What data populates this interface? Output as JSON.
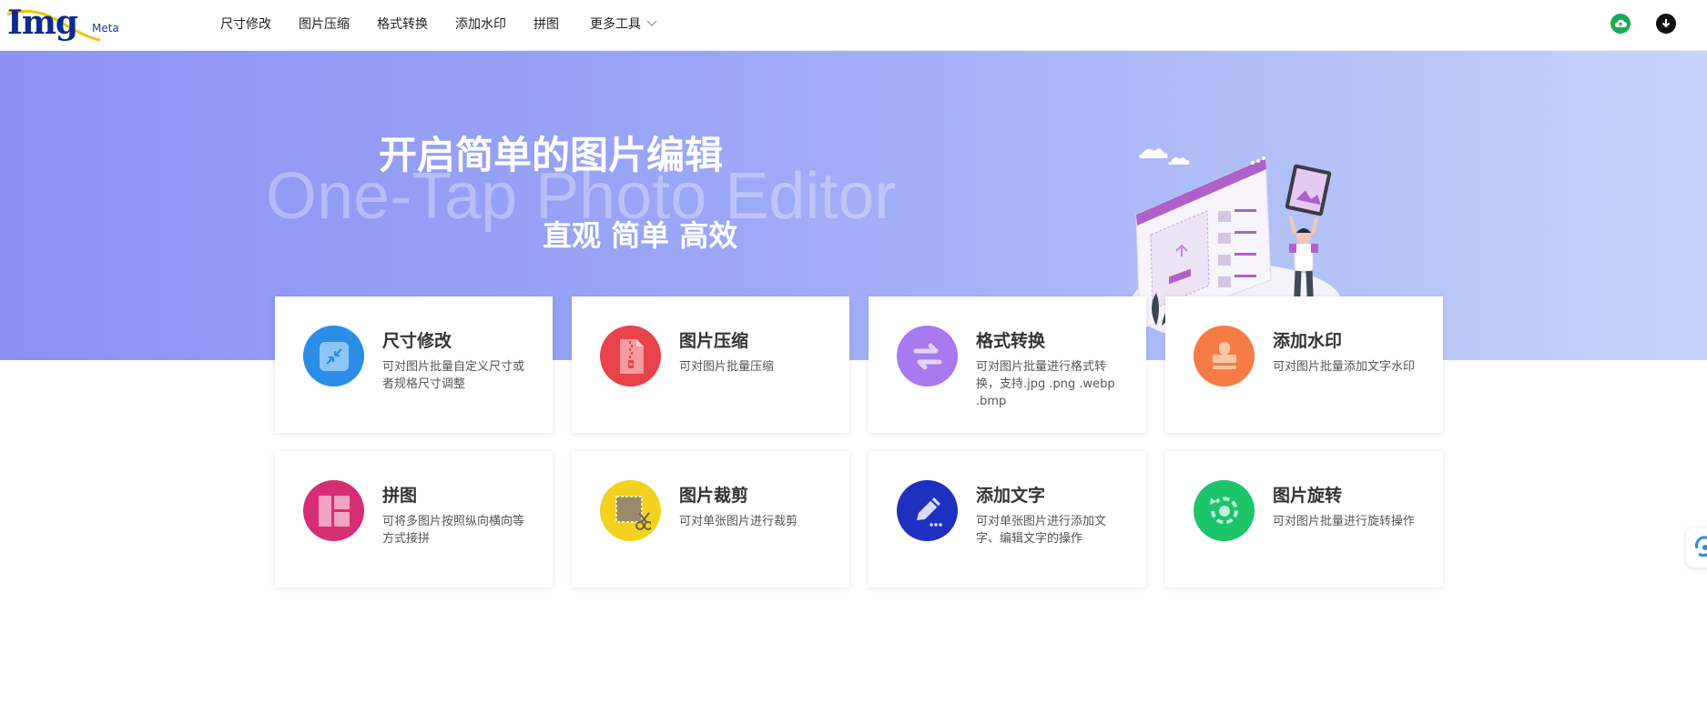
{
  "logo": {
    "main": "Img",
    "sub": "Meta"
  },
  "nav": {
    "items": [
      {
        "label": "尺寸修改"
      },
      {
        "label": "图片压缩"
      },
      {
        "label": "格式转换"
      },
      {
        "label": "添加水印"
      },
      {
        "label": "拼图"
      },
      {
        "label": "更多工具"
      }
    ]
  },
  "header_icons": [
    {
      "icon": "cloud-upload-icon",
      "color": "#1aaa55"
    },
    {
      "icon": "download-icon",
      "color": "#111111"
    }
  ],
  "hero": {
    "title": "开启简单的图片编辑",
    "bg_text": "One-Tap Photo Editor",
    "subtitle": "直观 简单 高效",
    "colors": {
      "gradient_start": "#8b92f4",
      "gradient_end": "#c6d4fb"
    }
  },
  "tools": [
    {
      "title": "尺寸修改",
      "desc": "可对图片批量自定义尺寸或者规格尺寸调整",
      "icon": "resize-icon",
      "color": "#2b8de8"
    },
    {
      "title": "图片压缩",
      "desc": "可对图片批量压缩",
      "icon": "compress-zip-icon",
      "color": "#e8424a"
    },
    {
      "title": "格式转换",
      "desc": "可对图片批量进行格式转换，支持.jpg .png .webp .bmp",
      "icon": "convert-arrows-icon",
      "color": "#a77af0"
    },
    {
      "title": "添加水印",
      "desc": "可对图片批量添加文字水印",
      "icon": "stamp-icon",
      "color": "#f57c45"
    },
    {
      "title": "拼图",
      "desc": "可将多图片按照纵向横向等方式接拼",
      "icon": "collage-icon",
      "color": "#d62e74"
    },
    {
      "title": "图片裁剪",
      "desc": "可对单张图片进行裁剪",
      "icon": "crop-scissors-icon",
      "color": "#f2d21e"
    },
    {
      "title": "添加文字",
      "desc": "可对单张图片进行添加文字、编辑文字的操作",
      "icon": "pencil-icon",
      "color": "#1f2fbf"
    },
    {
      "title": "图片旋转",
      "desc": "可对图片批量进行旋转操作",
      "icon": "rotate-icon",
      "color": "#1cc46a"
    }
  ]
}
